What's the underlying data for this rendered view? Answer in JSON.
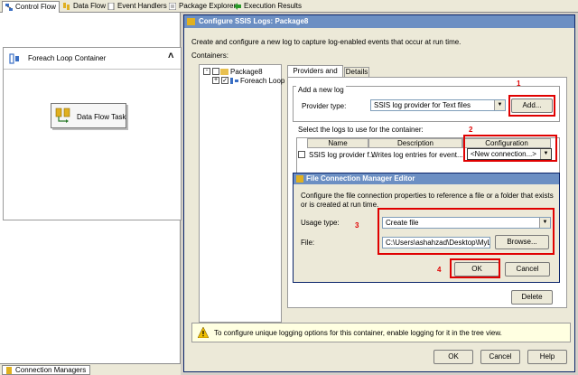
{
  "tabs": [
    {
      "label": "Control Flow",
      "icon": "control-flow-icon"
    },
    {
      "label": "Data Flow",
      "icon": "data-flow-icon"
    },
    {
      "label": "Event Handlers",
      "icon": "event-handlers-icon"
    },
    {
      "label": "Package Explorer",
      "icon": "package-explorer-icon"
    },
    {
      "label": "Execution Results",
      "icon": "execution-results-icon"
    }
  ],
  "designer": {
    "container_label": "Foreach Loop Container",
    "task_label": "Data Flow Task",
    "collapse_glyph": "˄"
  },
  "bottom": {
    "conn_label": "Connection Managers"
  },
  "dialog": {
    "title": "Configure SSIS Logs: Package8",
    "description": "Create and configure a new log to capture log-enabled events that occur at run time.",
    "containers_label": "Containers:",
    "tree": {
      "root": "Package8",
      "child": "Foreach Loop C"
    },
    "tabs": [
      "Providers and Logs",
      "Details"
    ],
    "add_group": "Add a new log",
    "provider_type_label": "Provider type:",
    "provider_type_value": "SSIS log provider for Text files",
    "add_button": "Add...",
    "select_logs_label": "Select the logs to use for the container:",
    "columns": [
      "Name",
      "Description",
      "Configuration"
    ],
    "row": {
      "name": "SSIS log provider f...",
      "description": "Writes log entries for event...",
      "configuration": "<New connection...>"
    },
    "delete_button": "Delete",
    "info_text": "To configure unique logging options for this container, enable logging for it in the tree view.",
    "ok": "OK",
    "cancel": "Cancel",
    "help": "Help"
  },
  "sub": {
    "title": "File Connection Manager Editor",
    "description": "Configure the file connection properties to reference a file or a folder that exists or is created at run time.",
    "usage_label": "Usage type:",
    "usage_value": "Create file",
    "file_label": "File:",
    "file_value": "C:\\Users\\ashahzad\\Desktop\\MyLogFile",
    "browse": "Browse...",
    "ok": "OK",
    "cancel": "Cancel"
  },
  "annotations": [
    "1",
    "2",
    "3",
    "4"
  ],
  "colors": {
    "accent_red": "#e00000",
    "title_blue": "#6c8fc3"
  }
}
